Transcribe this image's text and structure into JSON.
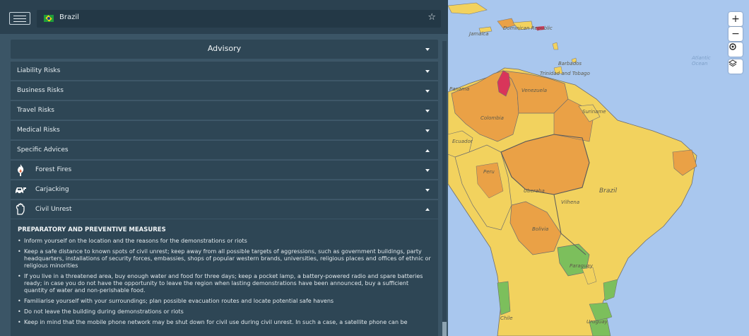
{
  "header": {
    "country": "Brazil"
  },
  "advisory": {
    "title": "Advisory"
  },
  "sections": [
    {
      "label": "Liability Risks"
    },
    {
      "label": "Business Risks"
    },
    {
      "label": "Travel Risks"
    },
    {
      "label": "Medical Risks"
    },
    {
      "label": "Specific Advices"
    }
  ],
  "specific": [
    {
      "label": "Forest Fires",
      "icon": "fire-icon"
    },
    {
      "label": "Carjacking",
      "icon": "carjacking-icon"
    },
    {
      "label": "Civil Unrest",
      "icon": "civil-unrest-icon"
    }
  ],
  "content": {
    "title": "PREPARATORY AND PREVENTIVE MEASURES",
    "bullets": [
      "Inform yourself on the location and the reasons for the demonstrations or riots",
      "Keep a safe distance to known spots of civil unrest; keep away from all possible targets of aggressions, such as government buildings, party headquarters, installations of security forces, embassies, shops of popular western brands, universities, religious places and offices of ethnic or religious minorities",
      "If you live in a threatened area, buy enough water and food for three days; keep a pocket lamp, a battery-powered radio and spare batteries ready; in case you do not have the opportunity to leave the region when lasting demonstrations have been announced, buy a sufficient quantity of water and non-perishable food.",
      "Familiarise yourself with your surroundings; plan possible evacuation routes and locate potential safe havens",
      "Do not leave the building during demonstrations or riots",
      "Keep in mind that the mobile phone network may be shut down for civil use during civil unrest. In such a case, a satellite phone can be"
    ]
  },
  "map": {
    "controls": {
      "zoom_in": "+",
      "zoom_out": "−"
    },
    "labels": {
      "dominican": "Dominican Republic",
      "jamaica": "Jamaica",
      "barbados": "Barbados",
      "trinidad": "Trinidad and Tobago",
      "atlantic": "Atlantic Ocean",
      "panama": "Panama",
      "venezuela": "Venezuela",
      "colombia": "Colombia",
      "suriname": "Suriname",
      "ecuador": "Ecuador",
      "peru": "Peru",
      "brazil": "Brazil",
      "uberaba": "Uberaba",
      "vilhena": "Vilhena",
      "bolivia": "Bolivia",
      "paraguay": "Paraguay",
      "chile": "Chile",
      "uruguay": "Uruguay"
    },
    "colors": {
      "water": "#a9c7ee",
      "low_risk": "#f2d25e",
      "medium_risk": "#eaa146",
      "high_risk": "#d76b2a",
      "minimal_risk": "#7cbf5c",
      "selected": "#d9355a"
    }
  }
}
